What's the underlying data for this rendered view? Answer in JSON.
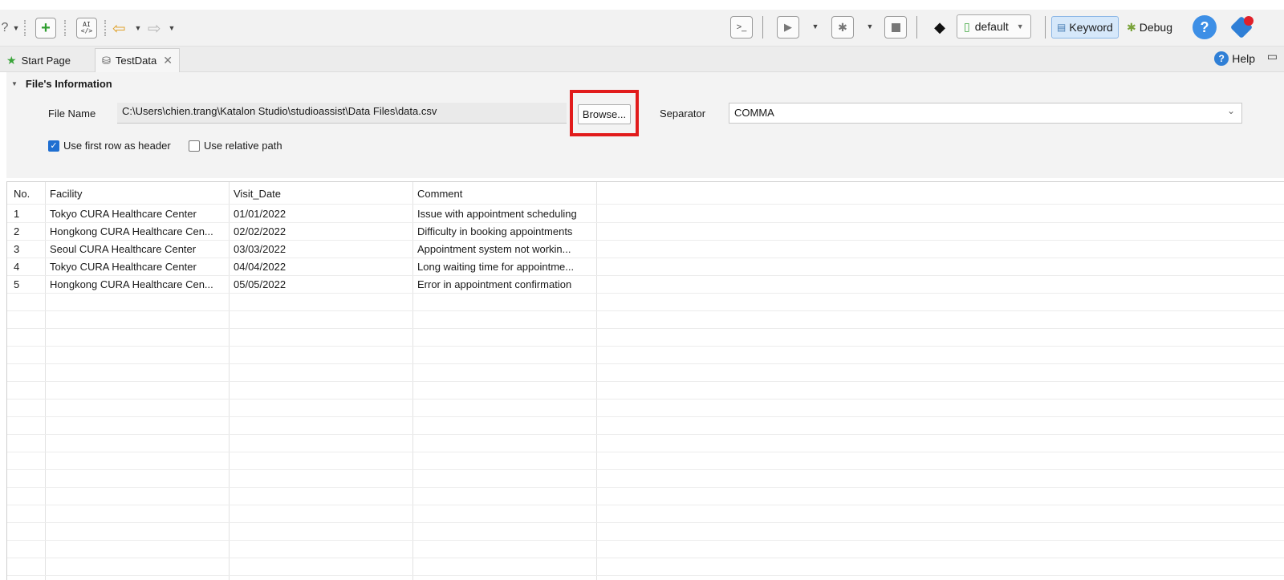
{
  "toolbar": {
    "profile": "default",
    "keyword_label": "Keyword",
    "debug_label": "Debug",
    "ai_icon_top": "AI",
    "ai_icon_bottom": "</>"
  },
  "tabs": [
    {
      "label": "Start Page",
      "icon": "star-icon"
    },
    {
      "label": "TestData",
      "icon": "database-icon"
    }
  ],
  "help_label": "Help",
  "file_info": {
    "section_title": "File's Information",
    "file_name_label": "File Name",
    "file_path": "C:\\Users\\chien.trang\\Katalon Studio\\studioassist\\Data Files\\data.csv",
    "browse_label": "Browse...",
    "separator_label": "Separator",
    "separator_value": "COMMA",
    "use_first_row_header": {
      "label": "Use first row as header",
      "checked": true
    },
    "use_relative_path": {
      "label": "Use relative path",
      "checked": false
    }
  },
  "table": {
    "columns": [
      "No.",
      "Facility",
      "Visit_Date",
      "Comment"
    ],
    "rows": [
      [
        "1",
        "Tokyo CURA Healthcare Center",
        "01/01/2022",
        "Issue with appointment scheduling"
      ],
      [
        "2",
        "Hongkong CURA Healthcare Cen...",
        "02/02/2022",
        "Difficulty in booking appointments"
      ],
      [
        "3",
        "Seoul CURA Healthcare Center",
        "03/03/2022",
        "Appointment system not workin..."
      ],
      [
        "4",
        "Tokyo CURA Healthcare Center",
        "04/04/2022",
        "Long waiting time for appointme..."
      ],
      [
        "5",
        "Hongkong CURA Healthcare Cen...",
        "05/05/2022",
        "Error in appointment confirmation"
      ]
    ]
  },
  "colors": {
    "highlight": "#e11b1b",
    "accent": "#1f6fd1"
  }
}
